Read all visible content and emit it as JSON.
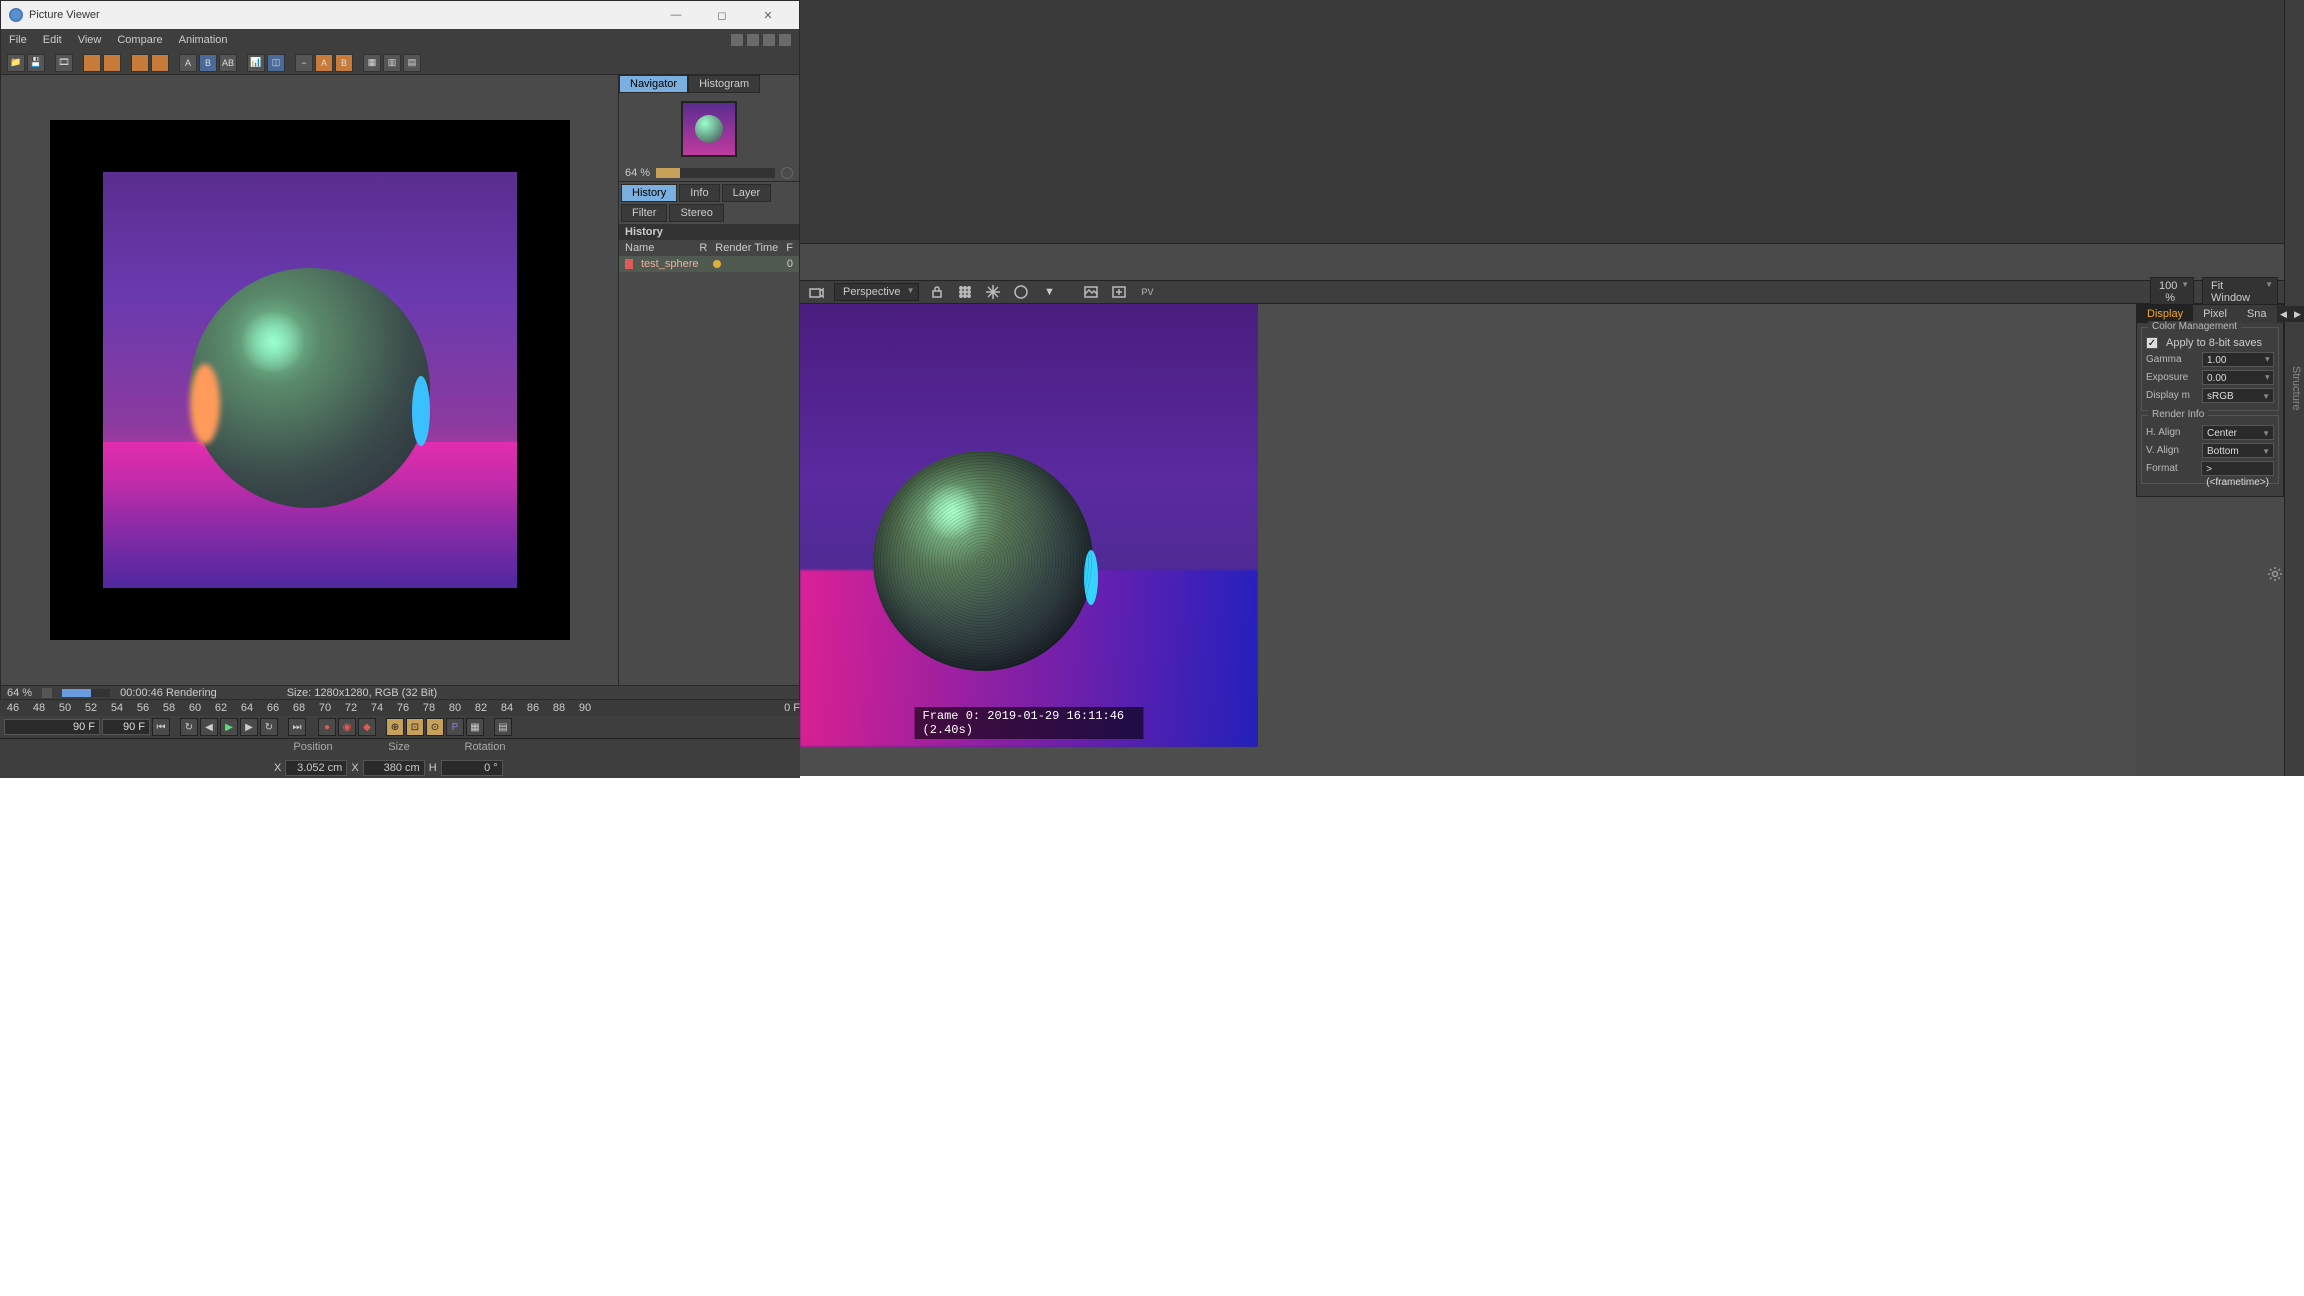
{
  "pv": {
    "title": "Picture Viewer",
    "menu": [
      "File",
      "Edit",
      "View",
      "Compare",
      "Animation"
    ],
    "nav_tabs": [
      "Navigator",
      "Histogram"
    ],
    "nav_zoom": "64 %",
    "side_tabs": [
      "History",
      "Info",
      "Layer",
      "Filter",
      "Stereo"
    ],
    "history_header": "History",
    "history_cols": {
      "name": "Name",
      "r": "R",
      "time": "Render Time",
      "f": "F"
    },
    "history_rows": [
      {
        "name": "test_sphere",
        "frames": "0"
      }
    ],
    "status": {
      "zoom": "64 %",
      "time": "00:00:46 Rendering",
      "size": "Size: 1280x1280, RGB (32 Bit)"
    }
  },
  "timeline": {
    "ticks": [
      "46",
      "48",
      "50",
      "52",
      "54",
      "56",
      "58",
      "60",
      "62",
      "64",
      "66",
      "68",
      "70",
      "72",
      "74",
      "76",
      "78",
      "80",
      "82",
      "84",
      "86",
      "88",
      "90"
    ],
    "frame_end_label": "0 F",
    "field_a": "90 F",
    "field_b": "90 F"
  },
  "coords": {
    "headers": [
      "Position",
      "Size",
      "Rotation"
    ],
    "x_label": "X",
    "x_pos": "3.052 cm",
    "x_size_label": "X",
    "x_size": "380 cm",
    "h_label": "H",
    "h_val": "0 °"
  },
  "viewport_bar": {
    "camera": "Perspective",
    "zoom": "100 %",
    "fit": "Fit Window"
  },
  "right_strip": "Structure",
  "rpanel": {
    "tabs": [
      "Display",
      "Pixel",
      "Sna"
    ],
    "cm": {
      "legend": "Color Management",
      "apply": "Apply to 8-bit saves",
      "gamma_l": "Gamma",
      "gamma": "1.00",
      "exposure_l": "Exposure",
      "exposure": "0.00",
      "display_l": "Display m",
      "display": "sRGB"
    },
    "ri": {
      "legend": "Render Info",
      "halign_l": "H. Align",
      "halign": "Center",
      "valign_l": "V. Align",
      "valign": "Bottom",
      "format_l": "Format",
      "format": "> (<frametime>)"
    }
  },
  "frame_label": "Frame  0:  2019-01-29  16:11:46  (2.40s)"
}
